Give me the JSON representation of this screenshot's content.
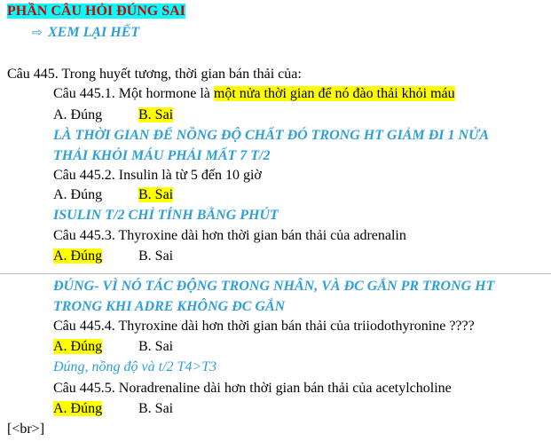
{
  "header": {
    "title": "PHẦN CÂU HỎI ĐÚNG SAI",
    "review_link": "XEM LẠI HẾT"
  },
  "question": {
    "stem": "Câu 445. Trong huyết tương, thời gian bán thải của:",
    "items": [
      {
        "prefix": "Câu 445.1. Một hormone là ",
        "highlight": "một nửa thời gian để nó đào thải khỏi máu",
        "option_a": "A. Đúng",
        "option_b": "B. Sai",
        "explanation_1": "LÀ THỜI GIAN ĐỂ NỒNG ĐỘ CHẤT ĐÓ TRONG HT GIẢM ĐI 1 NỬA",
        "explanation_2": "THẢI KHỎI MÁU PHẢI MẤT 7 T/2"
      },
      {
        "prefix": "Câu 445.2. Insulin là từ 5 đến 10 giờ",
        "option_a": "A. Đúng",
        "option_b": "B. Sai",
        "explanation_1": "ISULIN T/2 CHỈ TÍNH BẰNG PHÚT"
      },
      {
        "prefix": "Câu 445.3. Thyroxine dài hơn thời gian bán thải của adrenalin",
        "option_a": "A. Đúng",
        "option_b": "B. Sai",
        "explanation_1": "ĐÚNG- VÌ NÓ TÁC ĐỘNG TRONG NHÂN, VÀ ĐC GẮN PR TRONG HT",
        "explanation_2": "TRONG KHI ADRE KHÔNG ĐC GẮN"
      },
      {
        "prefix": "Câu 445.4. Thyroxine dài hơn thời gian bán thải của triiodothyronine ????",
        "option_a": "A. Đúng",
        "option_b": "B. Sai",
        "explanation_1": "Đúng, nồng độ và t/2 T4>T3"
      },
      {
        "prefix": "Câu 445.5.  Noradrenaline dài hơn thời gian bán thải của acetylcholine",
        "option_a": "A. Đúng",
        "option_b": "B. Sai"
      }
    ]
  },
  "footer": {
    "tag": "[<br>]"
  },
  "colors": {
    "highlight": "#ffff00",
    "title_bg": "#00ffff",
    "title_text": "#d40000",
    "explanation": "#2e9fd8"
  },
  "icons": {
    "review_arrow": "arrow-right-outline-icon"
  }
}
